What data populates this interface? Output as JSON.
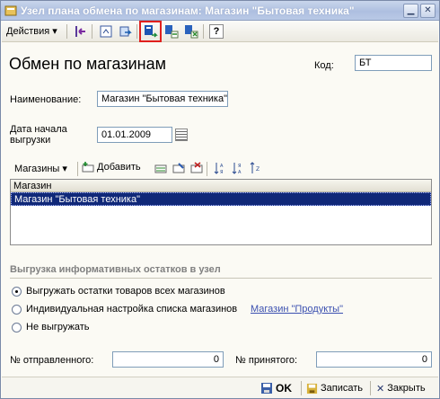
{
  "window": {
    "title": "Узел плана обмена по магазинам: Магазин \"Бытовая техника\""
  },
  "toolbar": {
    "actions_label": "Действия",
    "icons": [
      "back-arrow-icon",
      "find-icon",
      "refresh-icon",
      "exchange-highlighted-icon",
      "exchange-export-icon",
      "exchange-import-icon",
      "help-icon"
    ],
    "help_label": "?"
  },
  "form": {
    "title": "Обмен по магазинам",
    "code_label": "Код:",
    "code_value": "БТ",
    "name_label": "Наименование:",
    "name_value": "Магазин \"Бытовая техника\"",
    "date_label_line1": "Дата начала",
    "date_label_line2": "выгрузки",
    "date_value": "01.01.2009"
  },
  "shops": {
    "menu_label": "Магазины",
    "add_label": "Добавить",
    "column_header": "Магазин",
    "rows": [
      "Магазин \"Бытовая техника\""
    ]
  },
  "balances": {
    "section_title": "Выгрузка информативных остатков в узел",
    "option_all": "Выгружать остатки товаров всех магазинов",
    "option_individual": "Индивидуальная настройка списка магазинов",
    "individual_link": "Магазин \"Продукты\"",
    "option_none": "Не выгружать",
    "selected": "all"
  },
  "counters": {
    "sent_label": "№ отправленного:",
    "sent_value": "0",
    "received_label": "№ принятого:",
    "received_value": "0"
  },
  "footer": {
    "ok_label": "OK",
    "save_label": "Записать",
    "close_label": "Закрыть"
  },
  "colors": {
    "selection": "#102878",
    "link": "#3b50b0",
    "highlight_frame": "#e0201e"
  }
}
